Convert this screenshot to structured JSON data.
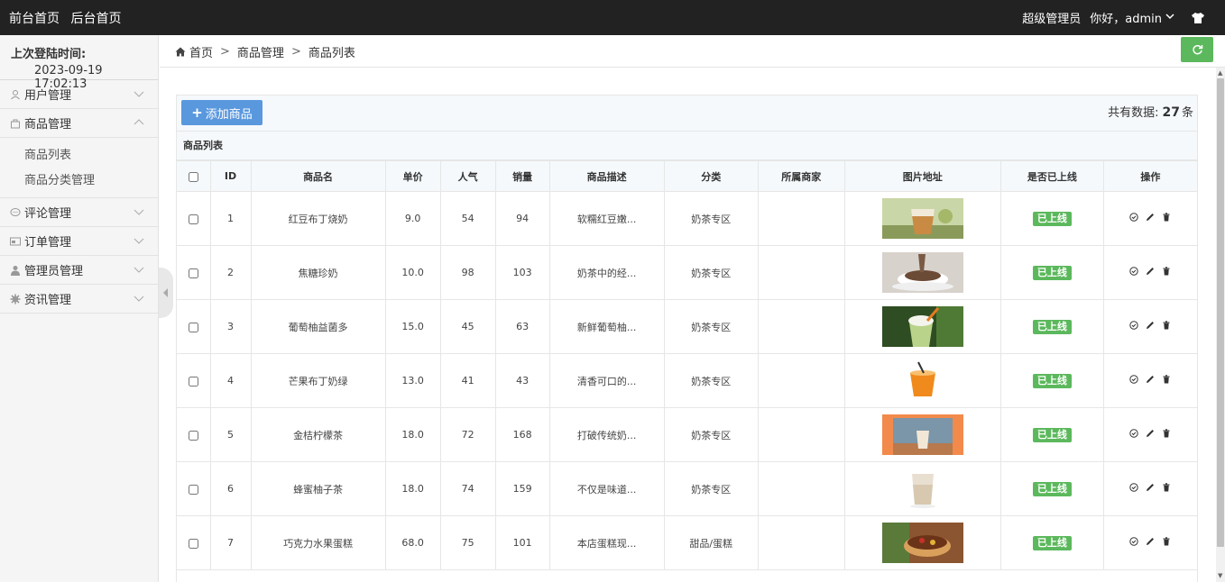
{
  "topbar": {
    "front_home": "前台首页",
    "back_home": "后台首页",
    "role": "超级管理员",
    "greeting": "你好，admin"
  },
  "sidebar": {
    "login_label": "上次登陆时间:",
    "login_time": "2023-09-19 17:02:13",
    "menu": {
      "users": "用户管理",
      "products": "商品管理",
      "product_list": "商品列表",
      "product_category": "商品分类管理",
      "comments": "评论管理",
      "orders": "订单管理",
      "admins": "管理员管理",
      "news": "资讯管理"
    }
  },
  "breadcrumb": {
    "home": "首页",
    "level1": "商品管理",
    "level2": "商品列表",
    "sep": ">"
  },
  "toolbar": {
    "add_label": "添加商品",
    "total_prefix": "共有数据:",
    "total_count": "27",
    "total_suffix": "条"
  },
  "table": {
    "title": "商品列表",
    "headers": {
      "id": "ID",
      "name": "商品名",
      "price": "单价",
      "popularity": "人气",
      "sales": "销量",
      "desc": "商品描述",
      "category": "分类",
      "merchant": "所属商家",
      "image": "图片地址",
      "online": "是否已上线",
      "ops": "操作"
    },
    "rows": [
      {
        "id": "1",
        "name": "红豆布丁烧奶",
        "price": "9.0",
        "popularity": "54",
        "sales": "94",
        "desc": "软糯红豆嫩...",
        "category": "奶茶专区",
        "merchant": "",
        "status": "已上线",
        "img": "tea-cup"
      },
      {
        "id": "2",
        "name": "焦糖珍奶",
        "price": "10.0",
        "popularity": "98",
        "sales": "103",
        "desc": "奶茶中的经...",
        "category": "奶茶专区",
        "merchant": "",
        "status": "已上线",
        "img": "hot-choc"
      },
      {
        "id": "3",
        "name": "葡萄柚益菌多",
        "price": "15.0",
        "popularity": "45",
        "sales": "63",
        "desc": "新鲜葡萄柚...",
        "category": "奶茶专区",
        "merchant": "",
        "status": "已上线",
        "img": "green-frappe"
      },
      {
        "id": "4",
        "name": "芒果布丁奶绿",
        "price": "13.0",
        "popularity": "41",
        "sales": "43",
        "desc": "清香可口的...",
        "category": "奶茶专区",
        "merchant": "",
        "status": "已上线",
        "img": "orange-cup"
      },
      {
        "id": "5",
        "name": "金桔柠檬茶",
        "price": "18.0",
        "popularity": "72",
        "sales": "168",
        "desc": "打破传统奶...",
        "category": "奶茶专区",
        "merchant": "",
        "status": "已上线",
        "img": "window-cup"
      },
      {
        "id": "6",
        "name": "蜂蜜柚子茶",
        "price": "18.0",
        "popularity": "74",
        "sales": "159",
        "desc": "不仅是味道...",
        "category": "奶茶专区",
        "merchant": "",
        "status": "已上线",
        "img": "milk-glass"
      },
      {
        "id": "7",
        "name": "巧克力水果蛋糕",
        "price": "68.0",
        "popularity": "75",
        "sales": "101",
        "desc": "本店蛋糕现...",
        "category": "甜品/蛋糕",
        "merchant": "",
        "status": "已上线",
        "img": "cake"
      }
    ]
  },
  "colors": {
    "topbar": "#222222",
    "add_button": "#5a98de",
    "success": "#5cb85c"
  }
}
